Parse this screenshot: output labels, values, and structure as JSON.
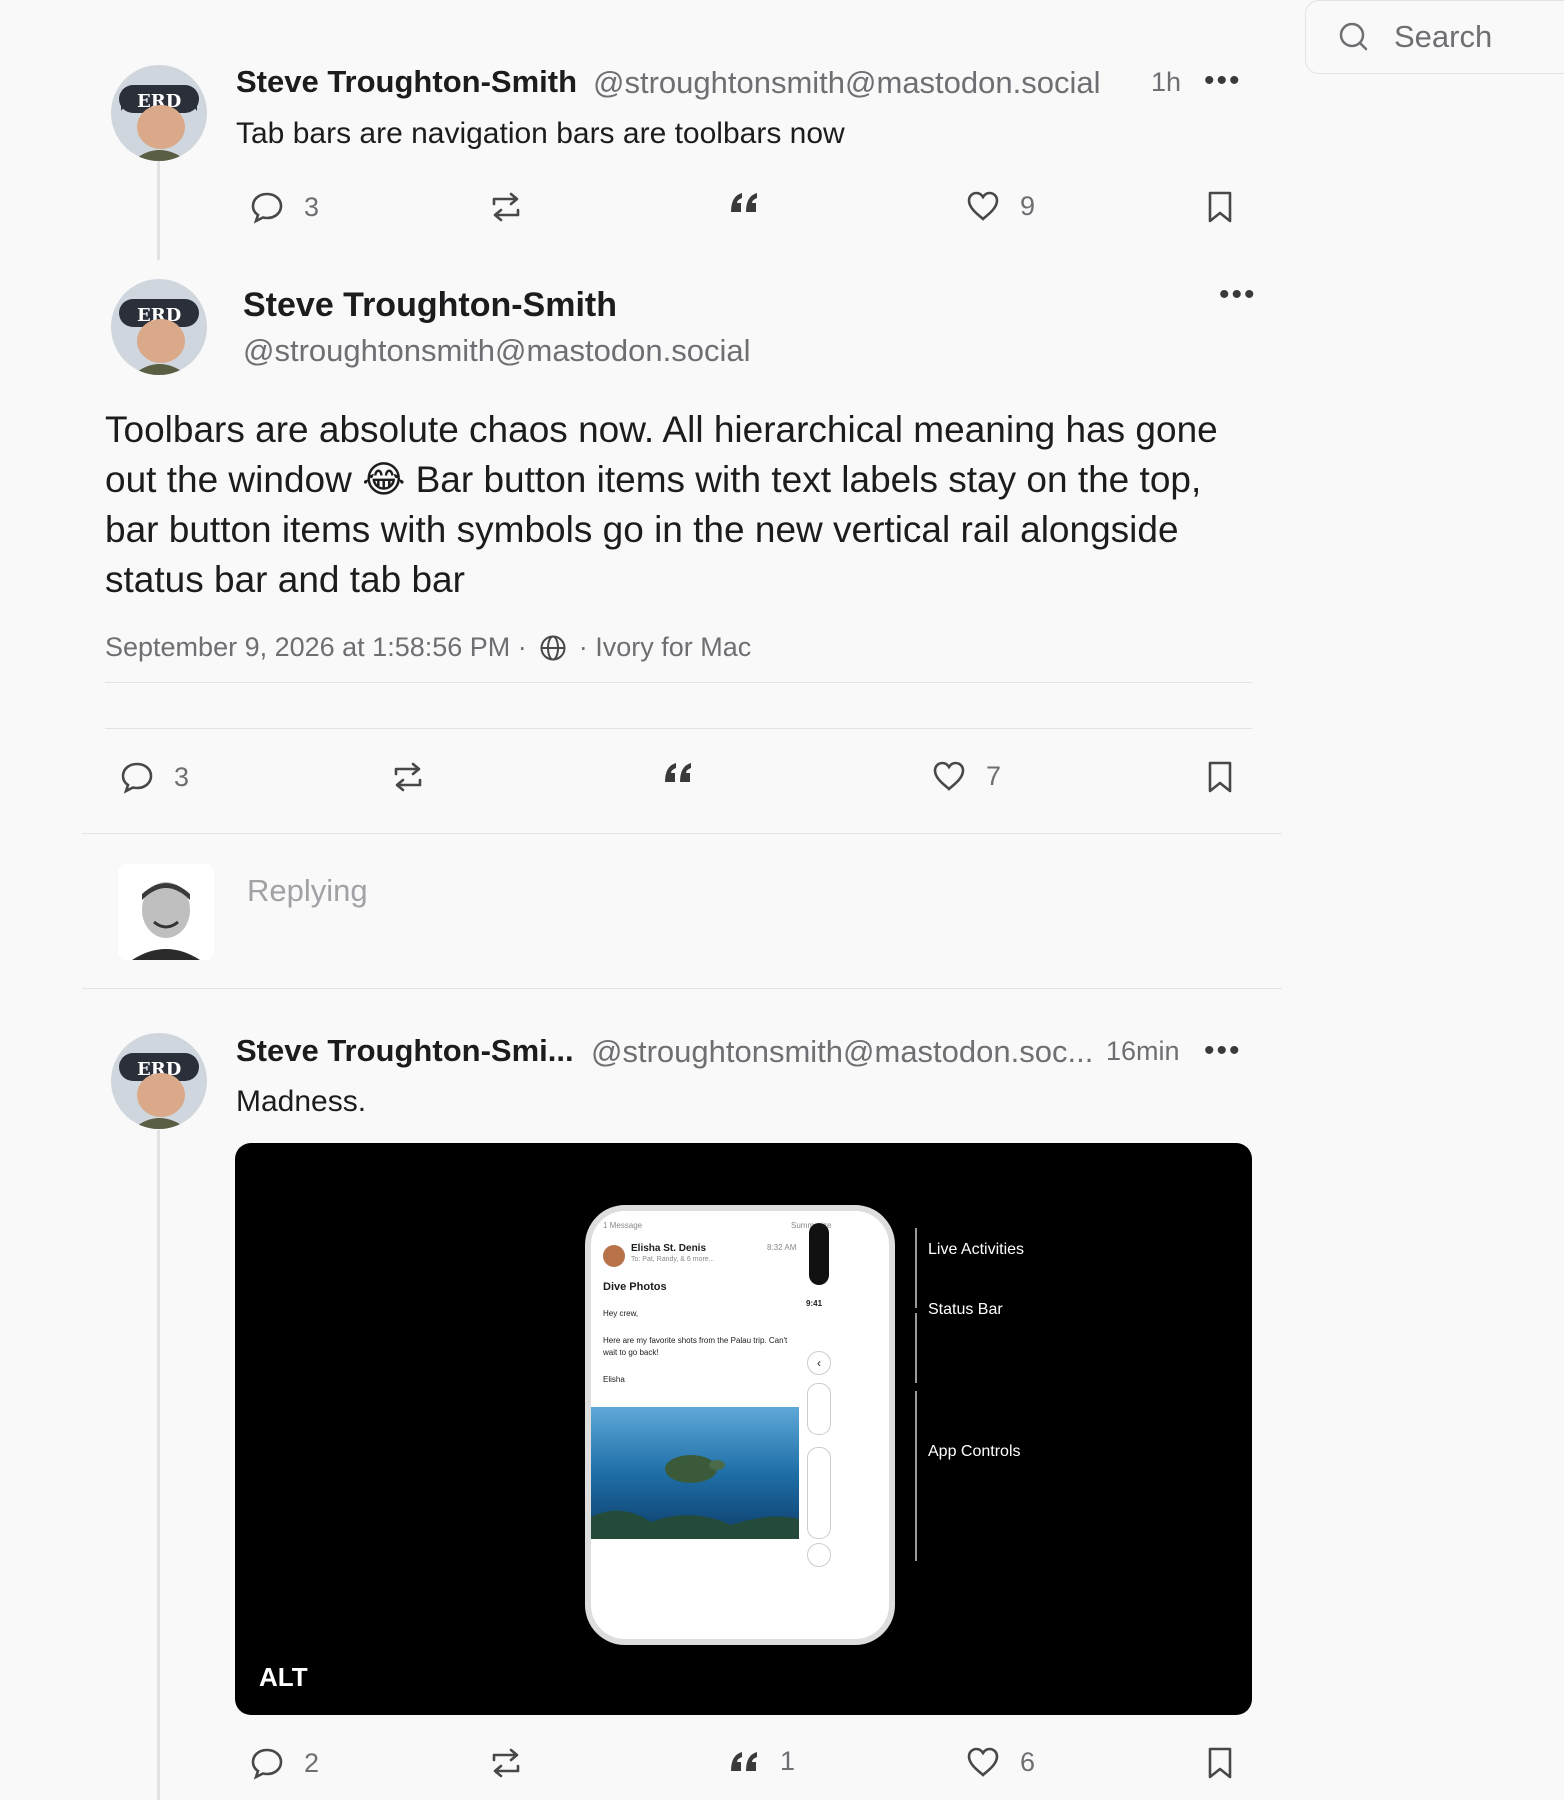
{
  "search": {
    "placeholder": "Search",
    "icon": "search-icon"
  },
  "posts": [
    {
      "name": "Steve Troughton-Smith",
      "handle": "@stroughtonsmith@mastodon.social",
      "time": "1h",
      "text": "Tab bars are navigation bars are toolbars now",
      "actions": {
        "replies": "3",
        "boosts": "",
        "quotes": "",
        "likes": "9"
      }
    }
  ],
  "focused": {
    "name": "Steve Troughton-Smith",
    "handle": "@stroughtonsmith@mastodon.social",
    "text_before_emoji": "Toolbars are absolute chaos now. All hierarchical meaning has gone out the window",
    "emoji": "😂",
    "text_after_emoji": " Bar button items with text labels stay on the top, bar button items with symbols go in the new vertical rail alongside status bar and tab bar",
    "meta_date": "September 9, 2026 at 1:58:56 PM ·",
    "meta_app": "· Ivory for Mac",
    "actions": {
      "replies": "3",
      "likes": "7"
    }
  },
  "reply_box": {
    "placeholder": "Replying"
  },
  "reply_post": {
    "name": "Steve Troughton-Smi...",
    "handle": "@stroughtonsmith@mastodon.soc...",
    "time": "16min",
    "text": "Madness.",
    "media_alt_badge": "ALT",
    "media": {
      "message_count": "1 Message",
      "summarize": "Summarize",
      "sender": "Elisha St. Denis",
      "sender_time": "8:32 AM",
      "to_line": "To: Pat, Randy, & 6 more...",
      "subject": "Dive Photos",
      "greeting": "Hey crew,",
      "body": "Here are my favorite shots from the Palau trip. Can't wait to go back!",
      "signoff": "Elisha",
      "rail_time": "9:41",
      "callouts": [
        "Live Activities",
        "Status Bar",
        "App Controls"
      ]
    },
    "actions": {
      "replies": "2",
      "quotes": "1",
      "likes": "6"
    }
  }
}
